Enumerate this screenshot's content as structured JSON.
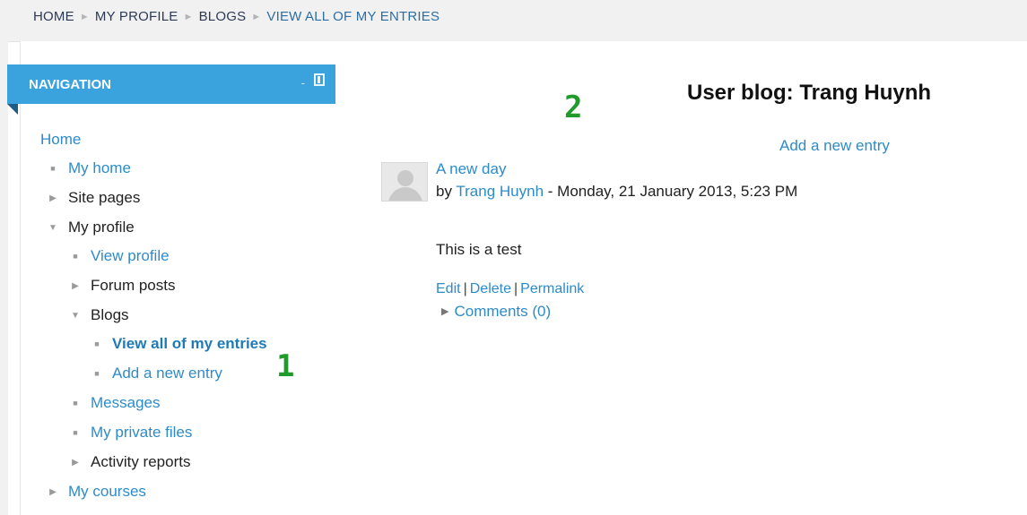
{
  "breadcrumb": {
    "items": [
      "HOME",
      "MY PROFILE",
      "BLOGS",
      "VIEW ALL OF MY ENTRIES"
    ],
    "separator": "►"
  },
  "navigation": {
    "title": "NAVIGATION",
    "minimize_symbol": "-",
    "items": [
      {
        "label": "Home",
        "marker": ""
      },
      {
        "label": "My home",
        "marker": "bullet"
      },
      {
        "label": "Site pages",
        "marker": "collapsed"
      },
      {
        "label": "My profile",
        "marker": "expanded"
      },
      {
        "label": "View profile",
        "marker": "bullet"
      },
      {
        "label": "Forum posts",
        "marker": "collapsed"
      },
      {
        "label": "Blogs",
        "marker": "expanded"
      },
      {
        "label": "View all of my entries",
        "marker": "bullet"
      },
      {
        "label": "Add a new entry",
        "marker": "bullet"
      },
      {
        "label": "Messages",
        "marker": "bullet"
      },
      {
        "label": "My private files",
        "marker": "bullet"
      },
      {
        "label": "Activity reports",
        "marker": "collapsed"
      },
      {
        "label": "My courses",
        "marker": "collapsed"
      }
    ]
  },
  "main": {
    "title": "User blog: Trang Huynh",
    "add_entry_label": "Add a new entry",
    "entry": {
      "title": "A new day",
      "by_prefix": "by",
      "author": "Trang Huynh",
      "date": "- Monday, 21 January 2013, 5:23 PM",
      "body": "This is a test",
      "actions": [
        "Edit",
        "Delete",
        "Permalink"
      ],
      "action_separator": "|",
      "comments_label": "Comments (0)"
    }
  },
  "annotations": {
    "one": "1",
    "two": "2"
  },
  "colors": {
    "accent": "#3aa2dc",
    "link": "#2d8bc9",
    "annotation": "#1f9a2b"
  }
}
